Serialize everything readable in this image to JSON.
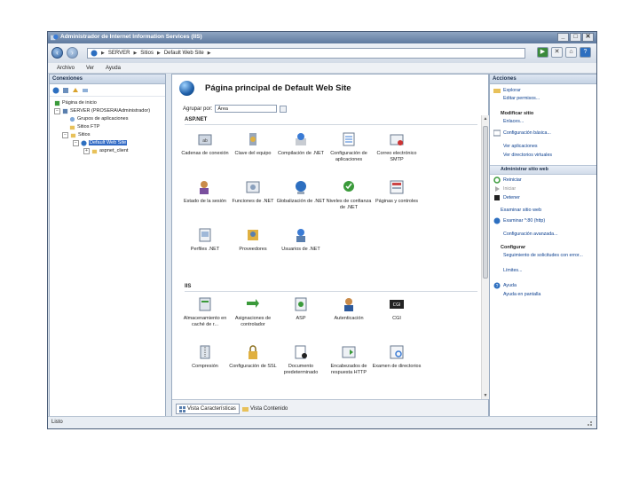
{
  "window": {
    "title": "Administrador de Internet Information Services (IIS)",
    "buttons": [
      "_",
      "□",
      "✕"
    ]
  },
  "address": {
    "path": [
      "SERVER",
      "Sitios",
      "Default Web Site"
    ]
  },
  "menu": [
    "Archivo",
    "Ver",
    "Ayuda"
  ],
  "connections": {
    "title": "Conexiones",
    "tree": [
      {
        "label": "Página de inicio",
        "level": 1
      },
      {
        "label": "SERVER (PROSERA\\Administrador)",
        "level": 1
      },
      {
        "label": "Grupos de aplicaciones",
        "level": 2
      },
      {
        "label": "Sitios FTP",
        "level": 2
      },
      {
        "label": "Sitios",
        "level": 2
      },
      {
        "label": "Default Web Site",
        "level": 3
      },
      {
        "label": "aspnet_client",
        "level": 4
      }
    ]
  },
  "center": {
    "title": "Página principal de Default Web Site",
    "filter_label": "Agrupar por:",
    "filter_value": "Área",
    "groups": [
      {
        "name": "ASP.NET",
        "items": [
          "Cadenas de conexión",
          "Clave del equipo",
          "Compilación de .NET",
          "Configuración de aplicaciones",
          "Correo electrónico SMTP",
          "Estado de la sesión",
          "Funciones de .NET",
          "Globalización de .NET",
          "Niveles de confianza de .NET",
          "Páginas y controles",
          "Perfiles .NET",
          "Proveedores",
          "Usuarios de .NET"
        ]
      },
      {
        "name": "IIS",
        "items": [
          "Almacenamiento en caché de r...",
          "Asignaciones de controlador",
          "ASP",
          "Autenticación",
          "CGI",
          "Compresión",
          "Configuración de SSL",
          "Documento predeterminado",
          "Encabezados de respuesta HTTP",
          "Examen de directorios"
        ]
      }
    ],
    "tabs": [
      "Vista Características",
      "Vista Contenido"
    ]
  },
  "actions": {
    "title": "Acciones",
    "items": [
      {
        "label": "Explorar",
        "style": "link"
      },
      {
        "label": "Editar permisos...",
        "style": "link"
      },
      {
        "label": "Modificar sitio",
        "style": "head"
      },
      {
        "label": "Enlaces...",
        "style": "link"
      },
      {
        "label": "Configuración básica...",
        "style": "link"
      },
      {
        "label": "Ver aplicaciones",
        "style": "link"
      },
      {
        "label": "Ver directorios virtuales",
        "style": "link"
      },
      {
        "label": "Administrar sitio web",
        "style": "section"
      },
      {
        "label": "Reiniciar",
        "style": "link"
      },
      {
        "label": "Iniciar",
        "style": "disabled"
      },
      {
        "label": "Detener",
        "style": "link"
      },
      {
        "label": "Examinar sitio web",
        "style": "head"
      },
      {
        "label": "Examinar *:80 (http)",
        "style": "link"
      },
      {
        "label": "Configuración avanzada...",
        "style": "link"
      },
      {
        "label": "Configurar",
        "style": "head"
      },
      {
        "label": "Seguimiento de solicitudes con error...",
        "style": "link"
      },
      {
        "label": "Límites...",
        "style": "link"
      },
      {
        "label": "Ayuda",
        "style": "link"
      },
      {
        "label": "Ayuda en pantalla",
        "style": "link"
      }
    ]
  },
  "status": "Listo",
  "colors": {
    "accent": "#316ac5",
    "titlebar": "#5f7a9f",
    "link": "#0b3f8f"
  }
}
